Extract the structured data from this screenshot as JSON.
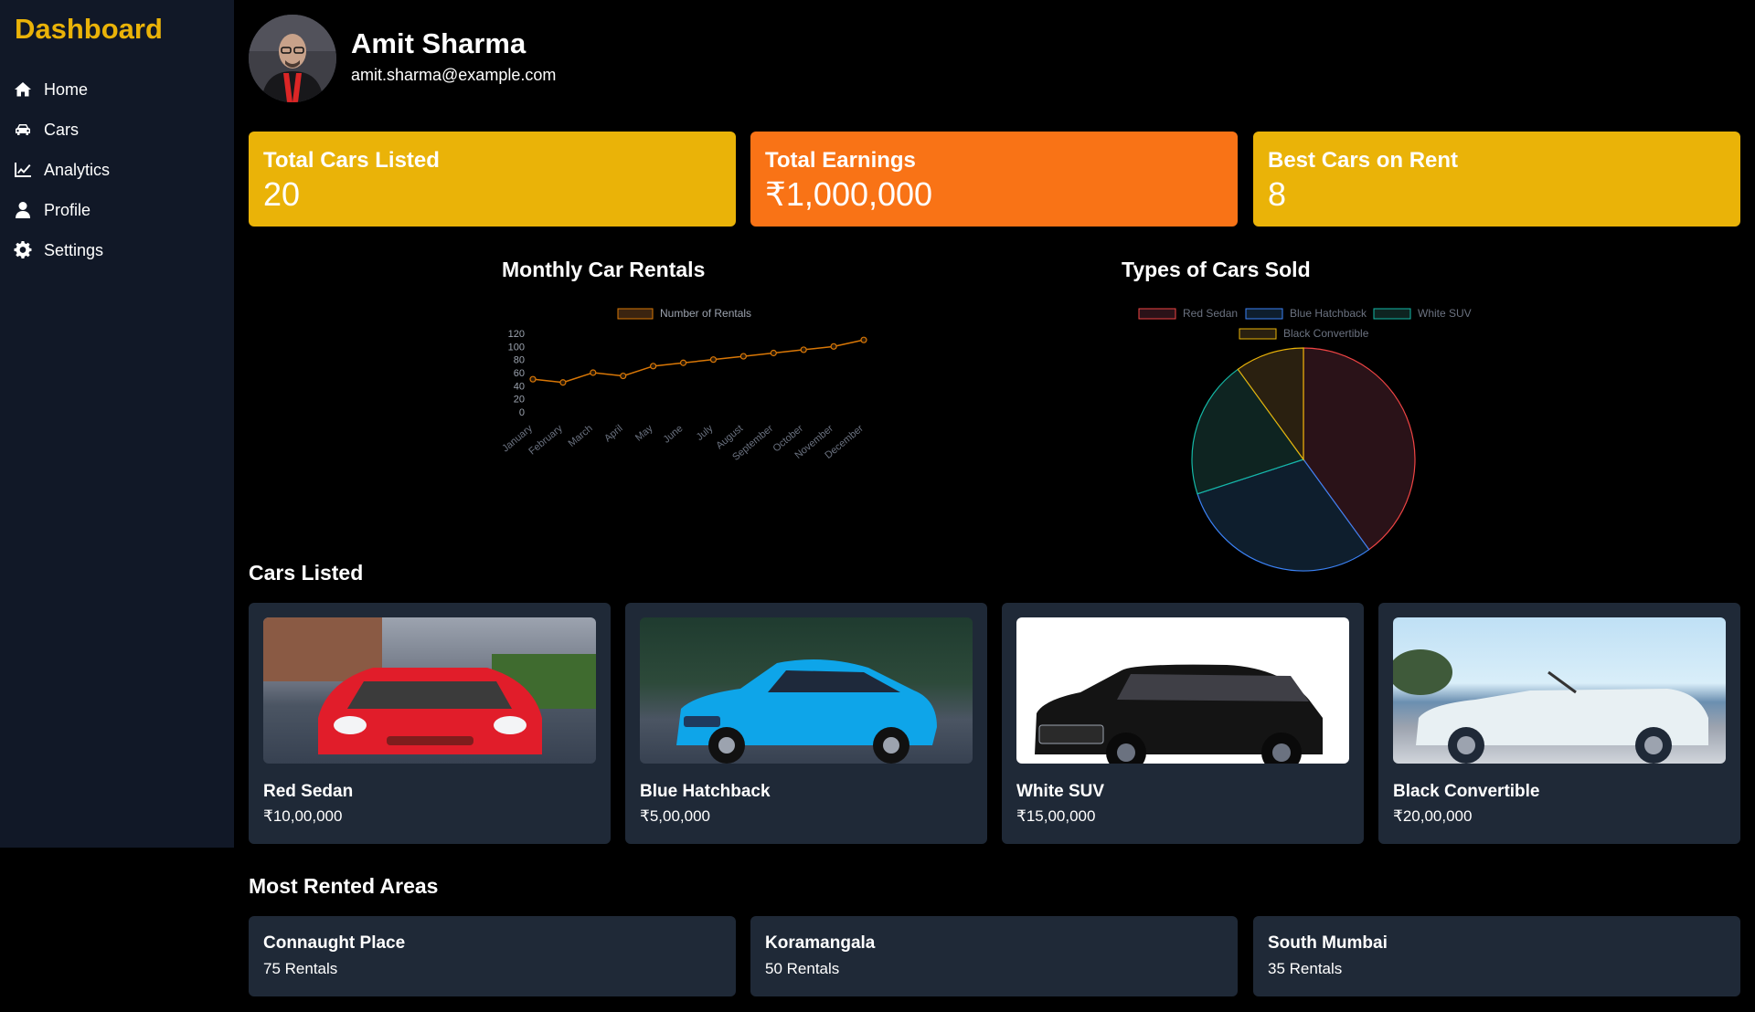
{
  "sidebar": {
    "brand": "Dashboard",
    "items": [
      {
        "label": "Home",
        "icon": "home-icon"
      },
      {
        "label": "Cars",
        "icon": "car-icon"
      },
      {
        "label": "Analytics",
        "icon": "chart-line-icon"
      },
      {
        "label": "Profile",
        "icon": "user-icon"
      },
      {
        "label": "Settings",
        "icon": "gear-icon"
      }
    ]
  },
  "user": {
    "name": "Amit Sharma",
    "email": "amit.sharma@example.com"
  },
  "stats": [
    {
      "label": "Total Cars Listed",
      "value": "20",
      "color": "#eab308"
    },
    {
      "label": "Total Earnings",
      "value": "₹1,000,000",
      "color": "#f97316"
    },
    {
      "label": "Best Cars on Rent",
      "value": "8",
      "color": "#eab308"
    }
  ],
  "charts": {
    "line_title": "Monthly Car Rentals",
    "pie_title": "Types of Cars Sold"
  },
  "chart_data": [
    {
      "type": "line",
      "title": "Monthly Car Rentals",
      "categories": [
        "January",
        "February",
        "March",
        "April",
        "May",
        "June",
        "July",
        "August",
        "September",
        "October",
        "November",
        "December"
      ],
      "series": [
        {
          "name": "Number of Rentals",
          "values": [
            50,
            45,
            60,
            55,
            70,
            75,
            80,
            85,
            90,
            95,
            100,
            110
          ],
          "color": "#d97706"
        }
      ],
      "yticks": [
        0,
        20,
        40,
        60,
        80,
        100,
        120
      ],
      "ylim": [
        0,
        120
      ],
      "legend": "top"
    },
    {
      "type": "pie",
      "title": "Types of Cars Sold",
      "labels": [
        "Red Sedan",
        "Blue Hatchback",
        "White SUV",
        "Black Convertible"
      ],
      "values": [
        40,
        30,
        20,
        10
      ],
      "colors": [
        "#ef4444",
        "#3b82f6",
        "#14b8a6",
        "#eab308"
      ],
      "fills": [
        "#2a1218",
        "#0e1e2d",
        "#0e2421",
        "#2a2010"
      ],
      "legend": "top"
    }
  ],
  "cars_section": {
    "title": "Cars Listed",
    "cars": [
      {
        "name": "Red Sedan",
        "price": "₹10,00,000",
        "color": "#dc2626"
      },
      {
        "name": "Blue Hatchback",
        "price": "₹5,00,000",
        "color": "#0284c7"
      },
      {
        "name": "White SUV",
        "price": "₹15,00,000",
        "color": "#111111"
      },
      {
        "name": "Black Convertible",
        "price": "₹20,00,000",
        "color": "#e5e7eb"
      }
    ]
  },
  "areas_section": {
    "title": "Most Rented Areas",
    "areas": [
      {
        "name": "Connaught Place",
        "count": "75 Rentals"
      },
      {
        "name": "Koramangala",
        "count": "50 Rentals"
      },
      {
        "name": "South Mumbai",
        "count": "35 Rentals"
      }
    ]
  }
}
